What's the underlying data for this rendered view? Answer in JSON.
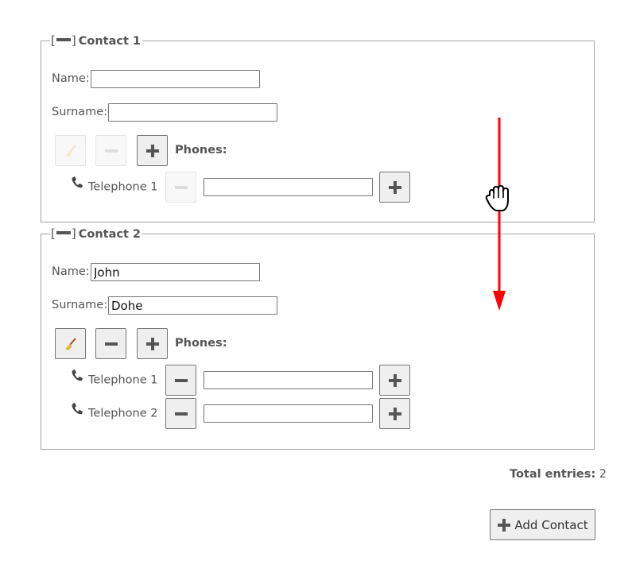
{
  "contacts": [
    {
      "toggle_open": "[",
      "toggle_close": "]",
      "title": "Contact 1",
      "name_label": "Name:",
      "name_value": "",
      "surname_label": "Surname:",
      "surname_value": "",
      "phones_label": "Phones:",
      "clear_enabled": false,
      "remove_enabled": false,
      "telephones": [
        {
          "label": "Telephone 1",
          "value": "",
          "remove_enabled": false
        }
      ]
    },
    {
      "toggle_open": "[",
      "toggle_close": "]",
      "title": "Contact 2",
      "name_label": "Name:",
      "name_value": "John",
      "surname_label": "Surname:",
      "surname_value": "Dohe",
      "phones_label": "Phones:",
      "clear_enabled": true,
      "remove_enabled": true,
      "telephones": [
        {
          "label": "Telephone 1",
          "value": "",
          "remove_enabled": true
        },
        {
          "label": "Telephone 2",
          "value": "",
          "remove_enabled": true
        }
      ]
    }
  ],
  "footer": {
    "total_label": "Total entries:",
    "total_value": "2",
    "add_contact_label": "Add Contact"
  },
  "icons": {
    "clear": "broom-icon",
    "remove": "minus-icon",
    "add": "plus-icon",
    "telephone": "telephone-icon",
    "cursor": "grab-hand-icon"
  },
  "colors": {
    "drag_arrow": "#ff0000",
    "text": "#555555",
    "border": "#a3a3a3"
  }
}
